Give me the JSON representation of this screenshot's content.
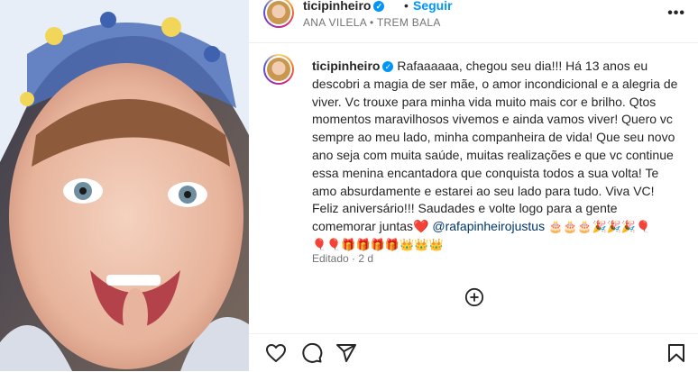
{
  "header": {
    "username": "ticipinheiro",
    "follow_label": "Seguir",
    "separator": "•",
    "music": "ANA VILELA • TREM BALA",
    "more_icon": "more-horizontal-icon"
  },
  "caption": {
    "username": "ticipinheiro",
    "text": "Rafaaaaaa, chegou seu dia!!! Há 13 anos eu descobri a magia de ser mãe, o amor incondicional e a alegria de viver. Vc trouxe para minha vida muito mais cor e brilho. Qtos momentos maravilhosos vivemos e ainda vamos viver! Quero vc sempre ao meu lado, minha companheira de vida! Que seu novo ano seja com muita saúde, muitas realizações e que vc continue essa menina encantadora que conquista todos a sua volta! Te amo absurdamente e estarei ao seu lado para tudo. Viva VC! Feliz aniversário!!! Saudades e volte logo para a gente comemorar juntas",
    "heart": "❤️",
    "mention": "@rafapinheirojustus",
    "emojis_line1": "🎂🎂🎂🎉🎉🎉🎈",
    "emojis_line2": "🎈🎈🎁🎁🎁🎁👑👑👑",
    "edited": "Editado · 2 d"
  },
  "actions": {
    "like_icon": "heart-icon",
    "comment_icon": "comment-icon",
    "share_icon": "share-icon",
    "save_icon": "bookmark-icon",
    "add_comment_icon": "plus-circle-icon"
  }
}
